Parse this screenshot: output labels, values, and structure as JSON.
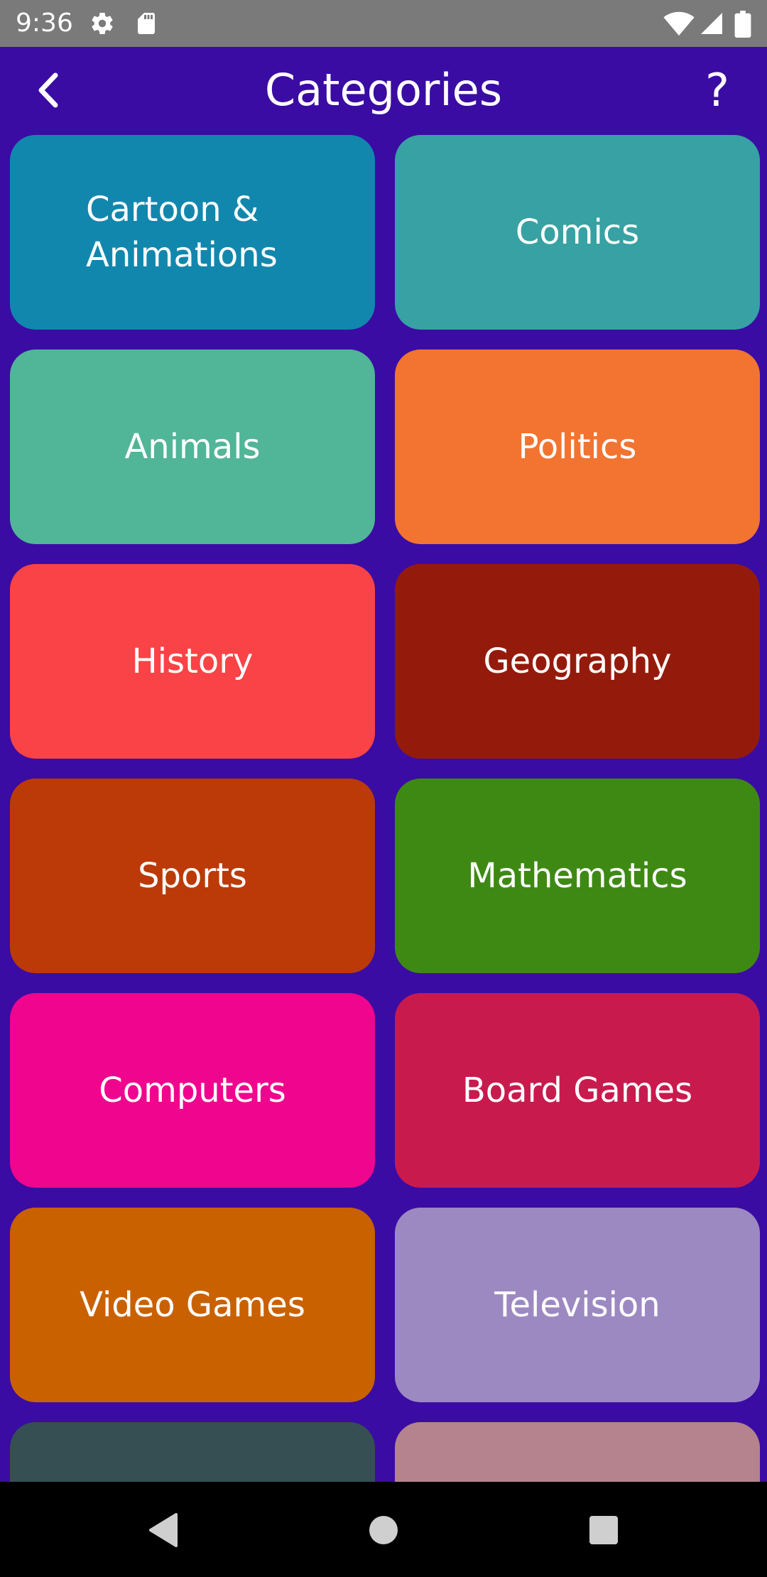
{
  "status_bar": {
    "time": "9:36",
    "icons": [
      "settings-icon",
      "sd-card-icon",
      "wifi-icon",
      "signal-icon",
      "battery-icon"
    ]
  },
  "app_bar": {
    "title": "Categories",
    "back_icon": "chevron-left-icon",
    "help_label": "?"
  },
  "categories": [
    {
      "label": "Cartoon & Animations",
      "color": "#1287ad"
    },
    {
      "label": "Comics",
      "color": "#37a1a3"
    },
    {
      "label": "Animals",
      "color": "#51b597"
    },
    {
      "label": "Politics",
      "color": "#f27430"
    },
    {
      "label": "History",
      "color": "#f94346"
    },
    {
      "label": "Geography",
      "color": "#941b0c"
    },
    {
      "label": "Sports",
      "color": "#bb3a08"
    },
    {
      "label": "Mathematics",
      "color": "#3e8914"
    },
    {
      "label": "Computers",
      "color": "#f0058e"
    },
    {
      "label": "Board Games",
      "color": "#c91a4e"
    },
    {
      "label": "Video Games",
      "color": "#c96101"
    },
    {
      "label": "Television",
      "color": "#9d89c1"
    },
    {
      "label": "",
      "color": "#354f52"
    },
    {
      "label": "",
      "color": "#b5838d"
    }
  ],
  "nav_bar": {
    "back_icon": "triangle-back-icon",
    "home_icon": "circle-home-icon",
    "recents_icon": "square-recents-icon"
  },
  "colors": {
    "background": "#3a0ca3",
    "status_bar": "#7a7a7a",
    "nav_bar": "#000000"
  }
}
